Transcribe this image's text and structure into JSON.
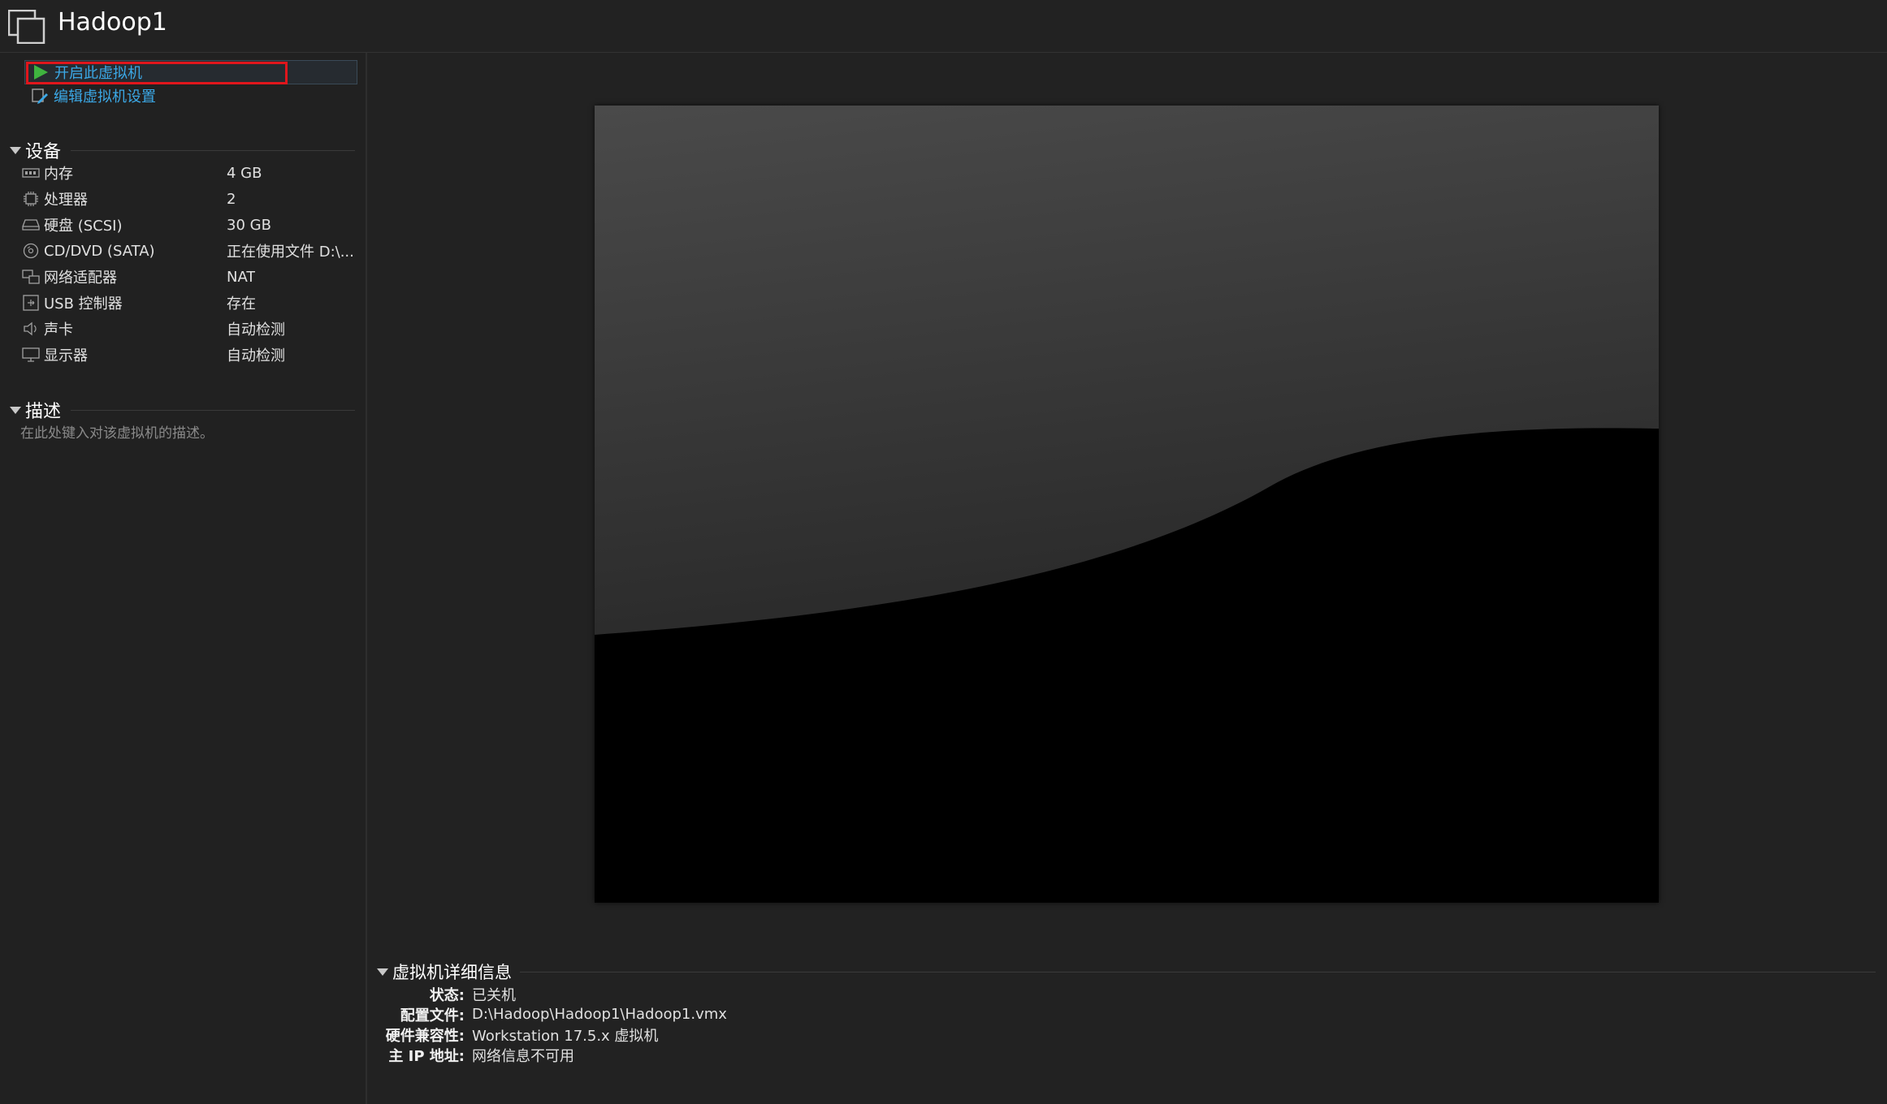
{
  "window": {
    "title": "Hadoop1"
  },
  "actions": {
    "start_vm": "开启此虚拟机",
    "edit_settings": "编辑虚拟机设置"
  },
  "devices": {
    "heading": "设备",
    "items": [
      {
        "name": "内存",
        "value": "4 GB",
        "icon": "memory-icon"
      },
      {
        "name": "处理器",
        "value": "2",
        "icon": "processor-icon"
      },
      {
        "name": "硬盘 (SCSI)",
        "value": "30 GB",
        "icon": "hard-disk-icon"
      },
      {
        "name": "CD/DVD (SATA)",
        "value": "正在使用文件 D:\\...",
        "icon": "cd-dvd-icon"
      },
      {
        "name": "网络适配器",
        "value": "NAT",
        "icon": "network-adapter-icon"
      },
      {
        "name": "USB 控制器",
        "value": "存在",
        "icon": "usb-controller-icon"
      },
      {
        "name": "声卡",
        "value": "自动检测",
        "icon": "sound-card-icon"
      },
      {
        "name": "显示器",
        "value": "自动检测",
        "icon": "display-icon"
      }
    ]
  },
  "description": {
    "heading": "描述",
    "placeholder": "在此处键入对该虚拟机的描述。"
  },
  "details": {
    "heading": "虚拟机详细信息",
    "rows": [
      {
        "label": "状态:",
        "value": "已关机"
      },
      {
        "label": "配置文件:",
        "value": "D:\\Hadoop\\Hadoop1\\Hadoop1.vmx"
      },
      {
        "label": "硬件兼容性:",
        "value": "Workstation 17.5.x 虚拟机"
      },
      {
        "label": "主 IP 地址:",
        "value": "网络信息不可用"
      }
    ]
  },
  "colors": {
    "background": "#222222",
    "link": "#3ba8e6",
    "highlight_box": "#e0161c",
    "play_green": "#3fb33f"
  }
}
